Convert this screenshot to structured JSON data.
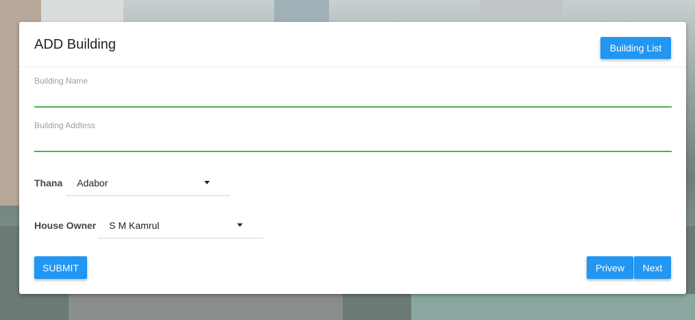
{
  "header": {
    "title": "ADD Building",
    "list_button": "Building List"
  },
  "form": {
    "building_name_label": "Building Name",
    "building_name_value": "",
    "building_address_label": "Building Addtess",
    "building_address_value": "",
    "thana": {
      "label": "Thana",
      "selected": "Adabor"
    },
    "house_owner": {
      "label": "House Owner",
      "selected": "S M Kamrul"
    }
  },
  "actions": {
    "submit": "SUBMIT",
    "preview": "Prive‌w",
    "next": "Next"
  },
  "colors": {
    "primary": "#2196f3",
    "input_underline": "#4caf50"
  }
}
